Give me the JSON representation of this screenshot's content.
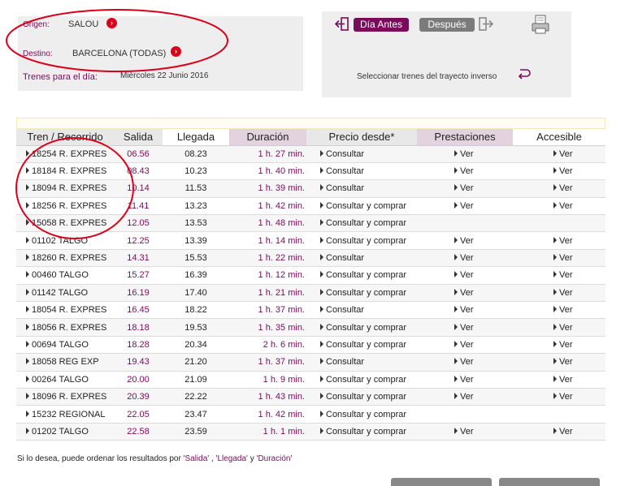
{
  "search": {
    "origin_label": "Origen:",
    "origin_value": "SALOU",
    "destination_label": "Destino:",
    "destination_value": "BARCELONA (TODAS)",
    "date_label": "Trenes para el día:",
    "date_value": "Miércoles  22  Junio  2016"
  },
  "nav": {
    "prev_day": "Día Antes",
    "next_day": "Después",
    "reverse_trip": "Seleccionar trenes del trayecto inverso"
  },
  "table": {
    "headers": [
      "Tren / Recorrido",
      "Salida",
      "Llegada",
      "Duración",
      "Precio desde*",
      "Prestaciones",
      "Accesible"
    ],
    "rows": [
      {
        "tren": "18254 R. EXPRES",
        "salida": "06.56",
        "llegada": "08.23",
        "duracion": "1 h. 27 min.",
        "precio": "Consultar",
        "prest": "Ver",
        "acc": "Ver"
      },
      {
        "tren": "18184 R. EXPRES",
        "salida": "08.43",
        "llegada": "10.23",
        "duracion": "1 h. 40 min.",
        "precio": "Consultar",
        "prest": "Ver",
        "acc": "Ver"
      },
      {
        "tren": "18094 R. EXPRES",
        "salida": "10.14",
        "llegada": "11.53",
        "duracion": "1 h. 39 min.",
        "precio": "Consultar",
        "prest": "Ver",
        "acc": "Ver"
      },
      {
        "tren": "18256 R. EXPRES",
        "salida": "11.41",
        "llegada": "13.23",
        "duracion": "1 h. 42 min.",
        "precio": "Consultar y comprar",
        "prest": "Ver",
        "acc": "Ver"
      },
      {
        "tren": "15058 R. EXPRES",
        "salida": "12.05",
        "llegada": "13.53",
        "duracion": "1 h. 48 min.",
        "precio": "Consultar y comprar",
        "prest": "",
        "acc": ""
      },
      {
        "tren": "01102 TALGO",
        "salida": "12.25",
        "llegada": "13.39",
        "duracion": "1 h. 14 min.",
        "precio": "Consultar y comprar",
        "prest": "Ver",
        "acc": "Ver"
      },
      {
        "tren": "18260 R. EXPRES",
        "salida": "14.31",
        "llegada": "15.53",
        "duracion": "1 h. 22 min.",
        "precio": "Consultar",
        "prest": "Ver",
        "acc": "Ver"
      },
      {
        "tren": "00460 TALGO",
        "salida": "15.27",
        "llegada": "16.39",
        "duracion": "1 h. 12 min.",
        "precio": "Consultar y comprar",
        "prest": "Ver",
        "acc": "Ver"
      },
      {
        "tren": "01142 TALGO",
        "salida": "16.19",
        "llegada": "17.40",
        "duracion": "1 h. 21 min.",
        "precio": "Consultar y comprar",
        "prest": "Ver",
        "acc": "Ver"
      },
      {
        "tren": "18054 R. EXPRES",
        "salida": "16.45",
        "llegada": "18.22",
        "duracion": "1 h. 37 min.",
        "precio": "Consultar",
        "prest": "Ver",
        "acc": "Ver"
      },
      {
        "tren": "18056 R. EXPRES",
        "salida": "18.18",
        "llegada": "19.53",
        "duracion": "1 h. 35 min.",
        "precio": "Consultar y comprar",
        "prest": "Ver",
        "acc": "Ver"
      },
      {
        "tren": "00694 TALGO",
        "salida": "18.28",
        "llegada": "20.34",
        "duracion": "2 h. 6 min.",
        "precio": "Consultar y comprar",
        "prest": "Ver",
        "acc": "Ver"
      },
      {
        "tren": "18058 REG EXP",
        "salida": "19.43",
        "llegada": "21.20",
        "duracion": "1 h. 37 min.",
        "precio": "Consultar",
        "prest": "Ver",
        "acc": "Ver"
      },
      {
        "tren": "00264 TALGO",
        "salida": "20.00",
        "llegada": "21.09",
        "duracion": "1 h. 9 min.",
        "precio": "Consultar y comprar",
        "prest": "Ver",
        "acc": "Ver"
      },
      {
        "tren": "18096 R. EXPRES",
        "salida": "20.39",
        "llegada": "22.22",
        "duracion": "1 h. 43 min.",
        "precio": "Consultar y comprar",
        "prest": "Ver",
        "acc": "Ver"
      },
      {
        "tren": "15232 REGIONAL",
        "salida": "22.05",
        "llegada": "23.47",
        "duracion": "1 h. 42 min.",
        "precio": "Consultar y comprar",
        "prest": "",
        "acc": ""
      },
      {
        "tren": "01202 TALGO",
        "salida": "22.58",
        "llegada": "23.59",
        "duracion": "1 h. 1 min.",
        "precio": "Consultar y comprar",
        "prest": "Ver",
        "acc": "Ver"
      }
    ]
  },
  "footer": {
    "sort_prefix": "Si lo desea, puede ordenar los resultados por",
    "sort_salida": "'Salida'",
    "sep1": " , ",
    "sort_llegada": "'Llegada'",
    "sep2": " y ",
    "sort_duracion": "'Duración'"
  },
  "colors": {
    "accent": "#7a0b5c",
    "annotation": "#d9001b",
    "next_button": "#7b7b7b"
  }
}
